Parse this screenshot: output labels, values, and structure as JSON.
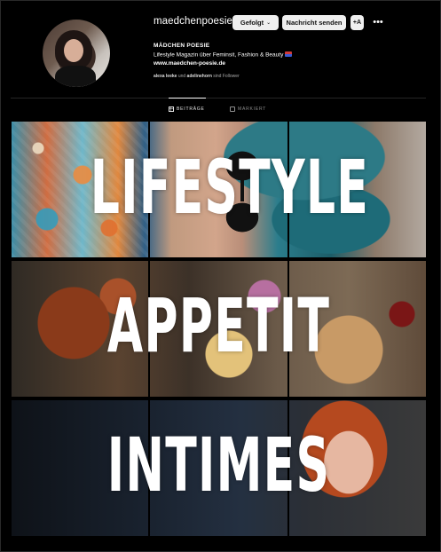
{
  "profile": {
    "username": "maedchenpoesie",
    "display_name": "MÄDCHEN POESIE",
    "bio": "Lifestyle Magazin über Feminsit, Fashion & Beauty",
    "website": "www.maedchen-poesie.de",
    "followed_by_user1": "alexa leeke",
    "followed_by_and": "und",
    "followed_by_user2": "adelinehorn",
    "followed_by_suffix": "sind Follower"
  },
  "actions": {
    "following_label": "Gefolgt",
    "message_label": "Nachricht senden",
    "add_label": "+A",
    "more_label": "•••"
  },
  "tabs": {
    "posts": "BEITRÄGE",
    "tagged": "MARKIERT"
  },
  "grid": {
    "words": [
      "LIFESTYLE",
      "APPETIT",
      "INTIMES"
    ]
  },
  "colors": {
    "background": "#000000",
    "button_bg": "#efefef",
    "divider": "#262626"
  }
}
